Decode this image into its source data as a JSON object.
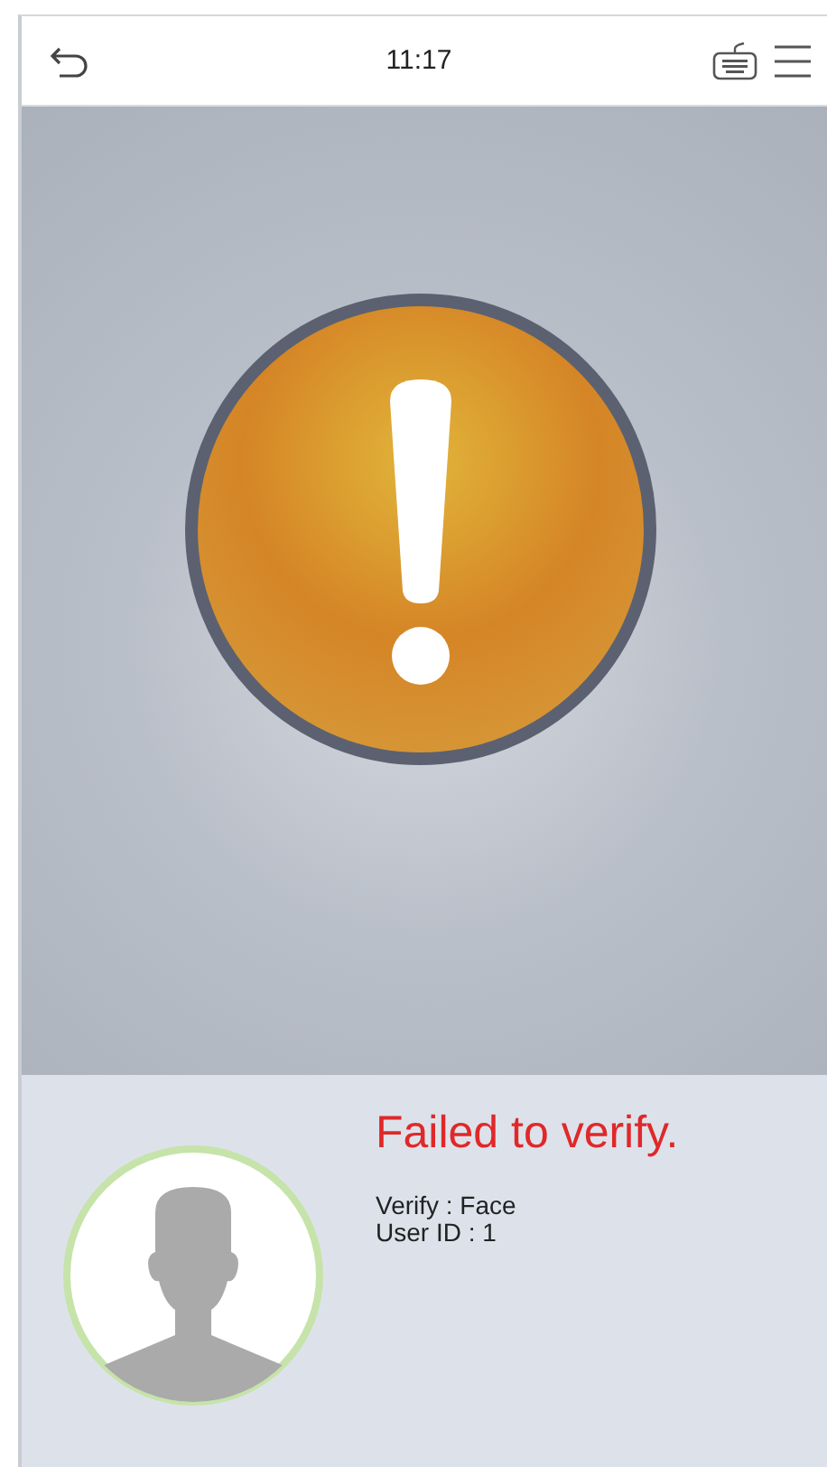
{
  "top_bar": {
    "time": "11:17"
  },
  "result": {
    "message": "Failed to verify.",
    "details": [
      "Verify : Face",
      "User ID : 1"
    ]
  }
}
